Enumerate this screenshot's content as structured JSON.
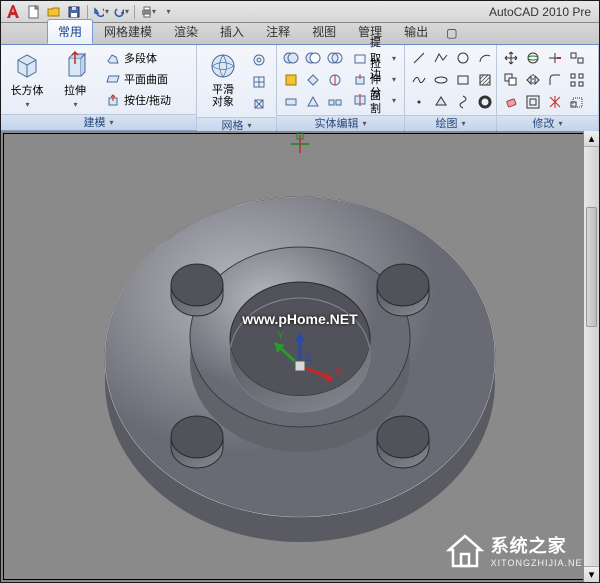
{
  "app": {
    "title": "AutoCAD 2010    Pre"
  },
  "qat": {
    "icons": [
      "new-icon",
      "open-icon",
      "save-icon",
      "undo-icon",
      "redo-icon",
      "print-icon"
    ]
  },
  "tabs": {
    "items": [
      {
        "label": "常用",
        "active": true
      },
      {
        "label": "网格建模"
      },
      {
        "label": "渲染"
      },
      {
        "label": "插入"
      },
      {
        "label": "注释"
      },
      {
        "label": "视图"
      },
      {
        "label": "管理"
      },
      {
        "label": "输出"
      }
    ]
  },
  "ribbon": {
    "panels": [
      {
        "name": "modeling",
        "title": "建模",
        "big": [
          {
            "label": "长方体"
          },
          {
            "label": "拉伸"
          }
        ],
        "rows": [
          {
            "label": "多段体"
          },
          {
            "label": "平面曲面"
          },
          {
            "label": "按住/拖动"
          }
        ]
      },
      {
        "name": "mesh",
        "title": "网格",
        "big": [
          {
            "label": "平滑\n对象"
          }
        ]
      },
      {
        "name": "solid-edit",
        "title": "实体编辑",
        "rows": [
          {
            "label": "提取边"
          },
          {
            "label": "拉伸面"
          },
          {
            "label": "分割"
          }
        ]
      },
      {
        "name": "draw",
        "title": "绘图"
      },
      {
        "name": "modify",
        "title": "修改"
      }
    ]
  },
  "viewport": {
    "watermark": "www.pHome.NET",
    "axes": {
      "x": "X",
      "y": "Y",
      "z": "Z"
    }
  },
  "brand": {
    "title": "系统之家",
    "sub": "XITONGZHIJIA.NET"
  }
}
